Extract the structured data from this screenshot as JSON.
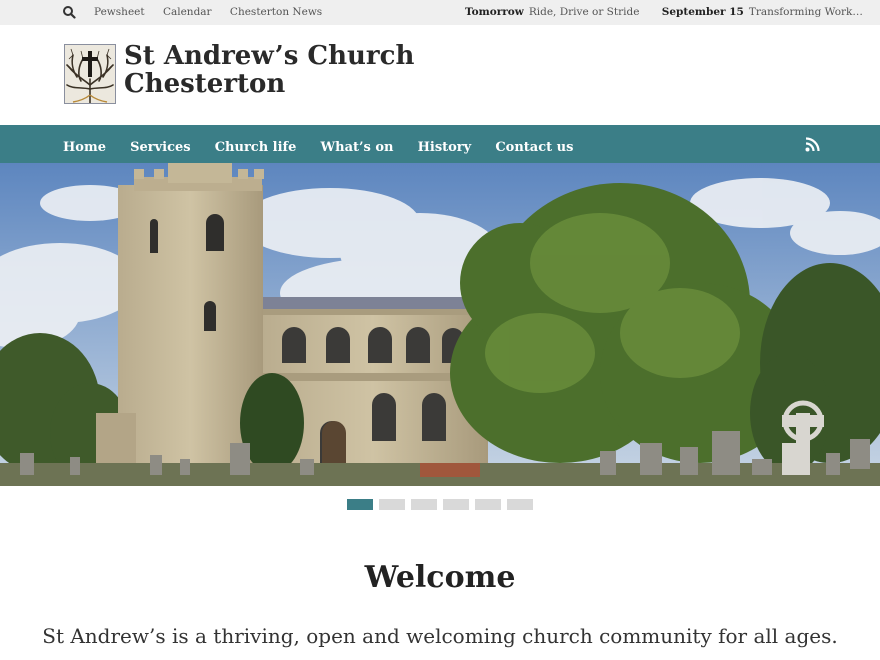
{
  "topbar": {
    "links": [
      "Pewsheet",
      "Calendar",
      "Chesterton News"
    ],
    "events": [
      {
        "when": "Tomorrow",
        "title": "Ride, Drive or Stride"
      },
      {
        "when": "September 15",
        "title": "Transforming Work…"
      }
    ]
  },
  "site": {
    "title_line1": "St Andrew’s Church",
    "title_line2": "Chesterton"
  },
  "nav": {
    "items": [
      "Home",
      "Services",
      "Church life",
      "What’s on",
      "History",
      "Contact us"
    ]
  },
  "slider": {
    "slide_count": 6,
    "active_index": 0
  },
  "welcome": {
    "heading": "Welcome",
    "text": "St Andrew’s is a thriving, open and welcoming church community for all ages."
  },
  "colors": {
    "accent": "#3b7e87",
    "topbar_bg": "#efefef"
  },
  "icons": {
    "search": "search-icon",
    "rss": "rss-icon"
  }
}
